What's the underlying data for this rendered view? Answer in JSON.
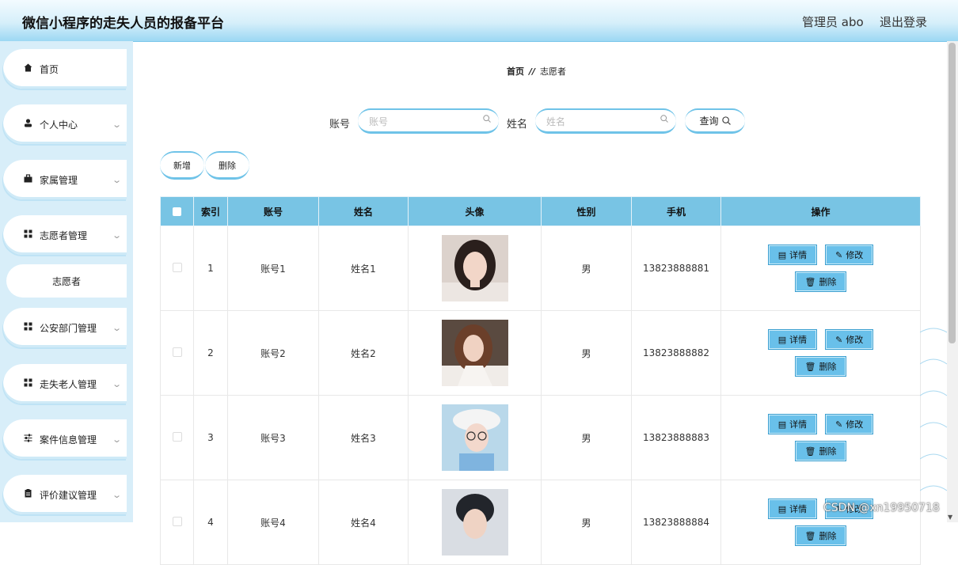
{
  "header": {
    "title": "微信小程序的走失人员的报备平台",
    "admin": "管理员 abo",
    "logout": "退出登录"
  },
  "sidebar": {
    "items": [
      {
        "label": "首页",
        "icon": "home-icon"
      },
      {
        "label": "个人中心",
        "icon": "user-icon"
      },
      {
        "label": "家属管理",
        "icon": "briefcase-icon"
      },
      {
        "label": "志愿者管理",
        "icon": "grid-icon"
      },
      {
        "label": "公安部门管理",
        "icon": "grid-icon"
      },
      {
        "label": "走失老人管理",
        "icon": "grid-icon"
      },
      {
        "label": "案件信息管理",
        "icon": "sliders-icon"
      },
      {
        "label": "评价建议管理",
        "icon": "clipboard-icon"
      }
    ],
    "submenu": {
      "label": "志愿者"
    }
  },
  "breadcrumb": {
    "home": "首页",
    "separator": "//",
    "current": "志愿者"
  },
  "search": {
    "account_label": "账号",
    "account_placeholder": "账号",
    "name_label": "姓名",
    "name_placeholder": "姓名",
    "query_label": "查询"
  },
  "actions": {
    "add": "新增",
    "delete": "删除"
  },
  "table": {
    "columns": [
      "索引",
      "账号",
      "姓名",
      "头像",
      "性别",
      "手机",
      "操作"
    ],
    "rows": [
      {
        "index": "1",
        "account": "账号1",
        "name": "姓名1",
        "gender": "男",
        "phone": "13823888881"
      },
      {
        "index": "2",
        "account": "账号2",
        "name": "姓名2",
        "gender": "男",
        "phone": "13823888882"
      },
      {
        "index": "3",
        "account": "账号3",
        "name": "姓名3",
        "gender": "男",
        "phone": "13823888883"
      },
      {
        "index": "4",
        "account": "账号4",
        "name": "姓名4",
        "gender": "男",
        "phone": "13823888884"
      }
    ],
    "op_labels": {
      "detail": "详情",
      "edit": "修改",
      "delete": "删除"
    }
  },
  "watermark": "CSDN @xn19950718",
  "colors": {
    "accent": "#78c4e4",
    "button": "#69c0ea",
    "sidebar_bg": "#d8eef9"
  }
}
